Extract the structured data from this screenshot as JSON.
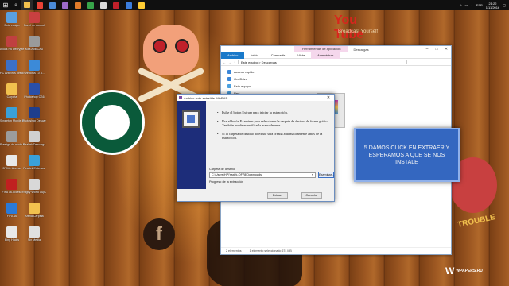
{
  "taskbar": {
    "apps": [
      {
        "name": "file-explorer",
        "color": "#f2c14e",
        "active": true
      },
      {
        "name": "chrome",
        "color": "#e94235"
      },
      {
        "name": "app-3",
        "color": "#4a8ad8"
      },
      {
        "name": "app-4",
        "color": "#9b6ac9"
      },
      {
        "name": "app-5",
        "color": "#e07a2a"
      },
      {
        "name": "app-6",
        "color": "#37a34a"
      },
      {
        "name": "app-7",
        "color": "#d8d8d8"
      },
      {
        "name": "app-8",
        "color": "#c0202a"
      },
      {
        "name": "app-9",
        "color": "#3b7ddd"
      },
      {
        "name": "app-10",
        "color": "#ffcc33"
      }
    ],
    "clock_time": "21:22",
    "clock_date": "1/11/2016",
    "lang": "ESP"
  },
  "desktop": {
    "column1": [
      {
        "label": "Este equipo",
        "color": "#5aa0e0"
      },
      {
        "label": "Alku's R6 Decrypter",
        "color": "#c04040"
      },
      {
        "label": "HC Antivirus direcion",
        "color": "#3d70c8"
      },
      {
        "label": "Carpeta",
        "color": "#f2c14e"
      },
      {
        "label": "Singleton Mobile B...",
        "color": "#3aa0d8"
      },
      {
        "label": "Prestige de modo.bp",
        "color": "#9c9c9c"
      },
      {
        "label": "DTIlite Acceso",
        "color": "#e8e8e8"
      },
      {
        "label": "FIFA 16 Acceso",
        "color": "#c02020"
      },
      {
        "label": "FIFA 16",
        "color": "#2a7ad8"
      },
      {
        "label": "Bing Hacks",
        "color": "#e8e8e8"
      }
    ],
    "column2": [
      {
        "label": "Panel de control",
        "color": "#c84040"
      },
      {
        "label": "Mas AutoCAD",
        "color": "#9a9a9a"
      },
      {
        "label": "Windows 10 a...",
        "color": "#3c8ad8"
      },
      {
        "label": "Photoshop CS6",
        "color": "#2a4fa8"
      },
      {
        "label": "Photoshop Descarga",
        "color": "#1f3e8c"
      },
      {
        "label": "Realtek Descarga",
        "color": "#d0d0d0"
      },
      {
        "label": "Realtek Extensor",
        "color": "#3aa0d8"
      },
      {
        "label": "Rugby World Cup 2015",
        "color": "#d8d8d8"
      },
      {
        "label": "Arena Carpeta",
        "color": "#f2c14e"
      },
      {
        "label": "Sin Media",
        "color": "#e0e0e0"
      }
    ]
  },
  "explorer": {
    "context_tab": "Herramientas de aplicación",
    "title": "Descargas",
    "ribbon_tabs": [
      "Archivo",
      "Inicio",
      "Compartir",
      "Vista",
      "Administrar"
    ],
    "path": "Este equipo  >  Descargas",
    "nav_items": [
      {
        "label": "Acceso rápido",
        "color": "#3a86d8"
      },
      {
        "label": "OneDrive",
        "color": "#3a86d8"
      },
      {
        "label": "Este equipo",
        "color": "#4aa0e0"
      },
      {
        "label": "Red",
        "color": "#4aa0e0"
      }
    ],
    "status_items": "2 elementos",
    "status_selected": "1 elemento seleccionado  674 MB"
  },
  "dialog": {
    "title": "Archivo auto-extraíble WinRAR",
    "bullets": [
      "Pulse el botón Extraer para iniciar la extracción.",
      "Use el botón Examinar para seleccionar la carpeta de destino de forma gráfica. También puede especificarla manualmente.",
      "Si la carpeta de destino no existe será creada automáticamente antes de la extracción."
    ],
    "dest_label": "Carpeta de destino",
    "dest_value": "C:\\Users\\HP\\Yaxirk-OF78\\Downloads\\",
    "browse_label": "Examinar...",
    "progress_label": "Progreso de la extracción",
    "extract_label": "Extraer",
    "cancel_label": "Cancelar"
  },
  "annotation": {
    "text": "5 DAMOS CLICK EN EXTRAER Y ESPERAMOS A QUE SE NOS INSTALE"
  },
  "wallpaper": {
    "youtube_text": "You Tube",
    "broadcast_text": "Broadcast Yourself",
    "trouble_text": "TROUBLE",
    "facebook_glyph": "f"
  },
  "watermark": {
    "logo_glyph": "W",
    "text": "WPAPERS.RU"
  }
}
